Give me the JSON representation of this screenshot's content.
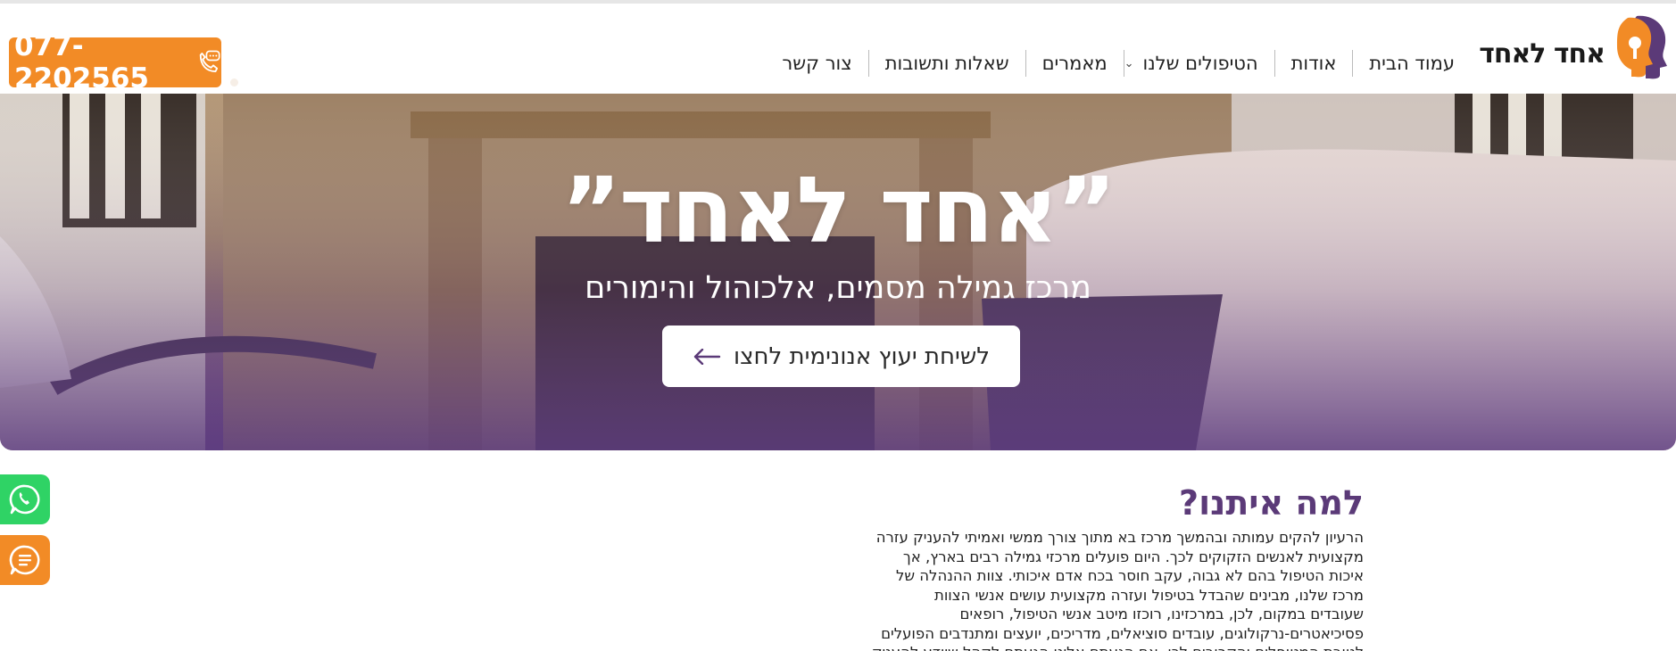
{
  "header": {
    "logo_text": "אחד לאחד",
    "logo_icon": "head-profile-icon",
    "phone": {
      "number": "077-2202565",
      "icon": "phone-chat-icon"
    }
  },
  "nav": {
    "items": [
      {
        "label": "עמוד הבית"
      },
      {
        "label": "אודות"
      },
      {
        "label": "הטיפולים שלנו",
        "has_dropdown": true
      },
      {
        "label": "מאמרים"
      },
      {
        "label": "שאלות ותשובות"
      },
      {
        "label": "צור קשר"
      }
    ]
  },
  "hero": {
    "title": "”אחד לאחד”",
    "subtitle": "מרכז גמילה מסמים, אלכוהול והימורים",
    "cta_label": "לשיחת יעוץ אנונימית לחצו",
    "cta_icon": "arrow-left-icon"
  },
  "floating": {
    "whatsapp_icon": "whatsapp-icon",
    "chat_icon": "chat-icon"
  },
  "section": {
    "title": "למה איתנו?",
    "lines": [
      "הרעיון להקים עמותה ובהמשך מרכז בא מתוך צורך ממשי ואמיתי להעניק עזרה",
      "מקצועית לאנשים הזקוקים לכך. היום פועלים מרכזי גמילה רבים בארץ, אך",
      "איכות הטיפול בהם לא גבוה, עקב חוסר בכח אדם איכותי. צוות ההנהלה של",
      "מרכז שלנו, מבינים שהבדל בטיפול ועזרה מקצועית עושים אנשי הצוות",
      "שעובדים במקום, לכן, במרכזינו, רוכזו מיטב אנשי הטיפול, רופאים",
      "פסיכיאטרים-נרקולוגים, עובדים סוציאלים, מדריכים, יועצים ומתנדבים הפועלים",
      "לטובת המטופלים והקרובים לכן, אם הגעתם אלינו הגעתם לקהל שיודע להעניק"
    ]
  },
  "colors": {
    "accent_orange": "#f28b26",
    "brand_purple": "#5b3a78",
    "whatsapp_green": "#2fd365"
  }
}
